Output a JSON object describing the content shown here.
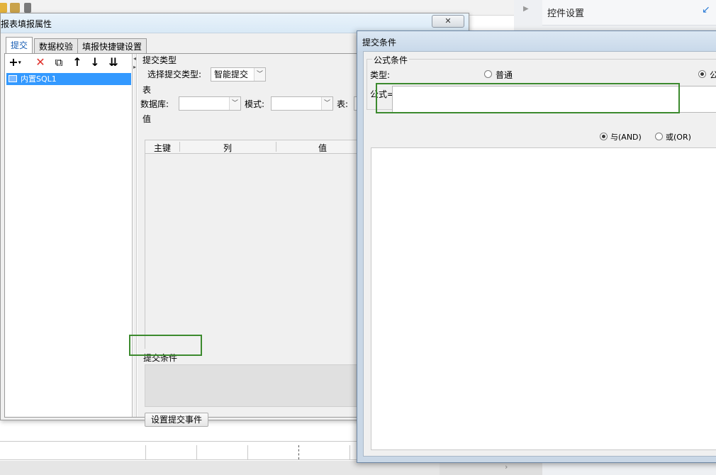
{
  "background_app": {
    "control_panel_title": "控件设置",
    "sheet_columns": 8
  },
  "dialog1": {
    "title": "报表填报属性",
    "close_glyph": "✕",
    "tabs": [
      {
        "label": "提交",
        "active": true
      },
      {
        "label": "数据校验",
        "active": false
      },
      {
        "label": "填报快捷键设置",
        "active": false
      }
    ],
    "tools": {
      "add": "+",
      "add_caret": "▾",
      "delete": "✕",
      "copy": "⧉",
      "up": "↑",
      "down": "↓",
      "more": "⇊"
    },
    "tree": {
      "items": [
        {
          "label": "内置SQL1",
          "selected": true
        }
      ]
    },
    "submit_type": {
      "section": "提交类型",
      "label": "选择提交类型:",
      "value": "智能提交"
    },
    "table_section": {
      "section": "表",
      "database_label": "数据库:",
      "database_value": "",
      "schema_label": "模式:",
      "schema_value": "",
      "table_label": "表:"
    },
    "value_section": {
      "section": "值",
      "columns": [
        "主键",
        "列",
        "值"
      ]
    },
    "submit_condition": {
      "label": "提交条件"
    },
    "event_button": "设置提交事件"
  },
  "dialog2": {
    "title": "提交条件",
    "group_label": "公式条件",
    "type_label": "类型:",
    "type_options": [
      {
        "label": "普通",
        "selected": false
      },
      {
        "label": "公",
        "selected": true
      }
    ],
    "formula_label": "公式=",
    "formula_value": "",
    "logic_options": [
      {
        "label": "与(AND)",
        "selected": true
      },
      {
        "label": "或(OR)",
        "selected": false
      }
    ]
  },
  "colors": {
    "selection": "#3399ff",
    "highlight": "#3c8a2e",
    "delete_red": "#e0302a",
    "accent_blue": "#1a5fb4"
  }
}
